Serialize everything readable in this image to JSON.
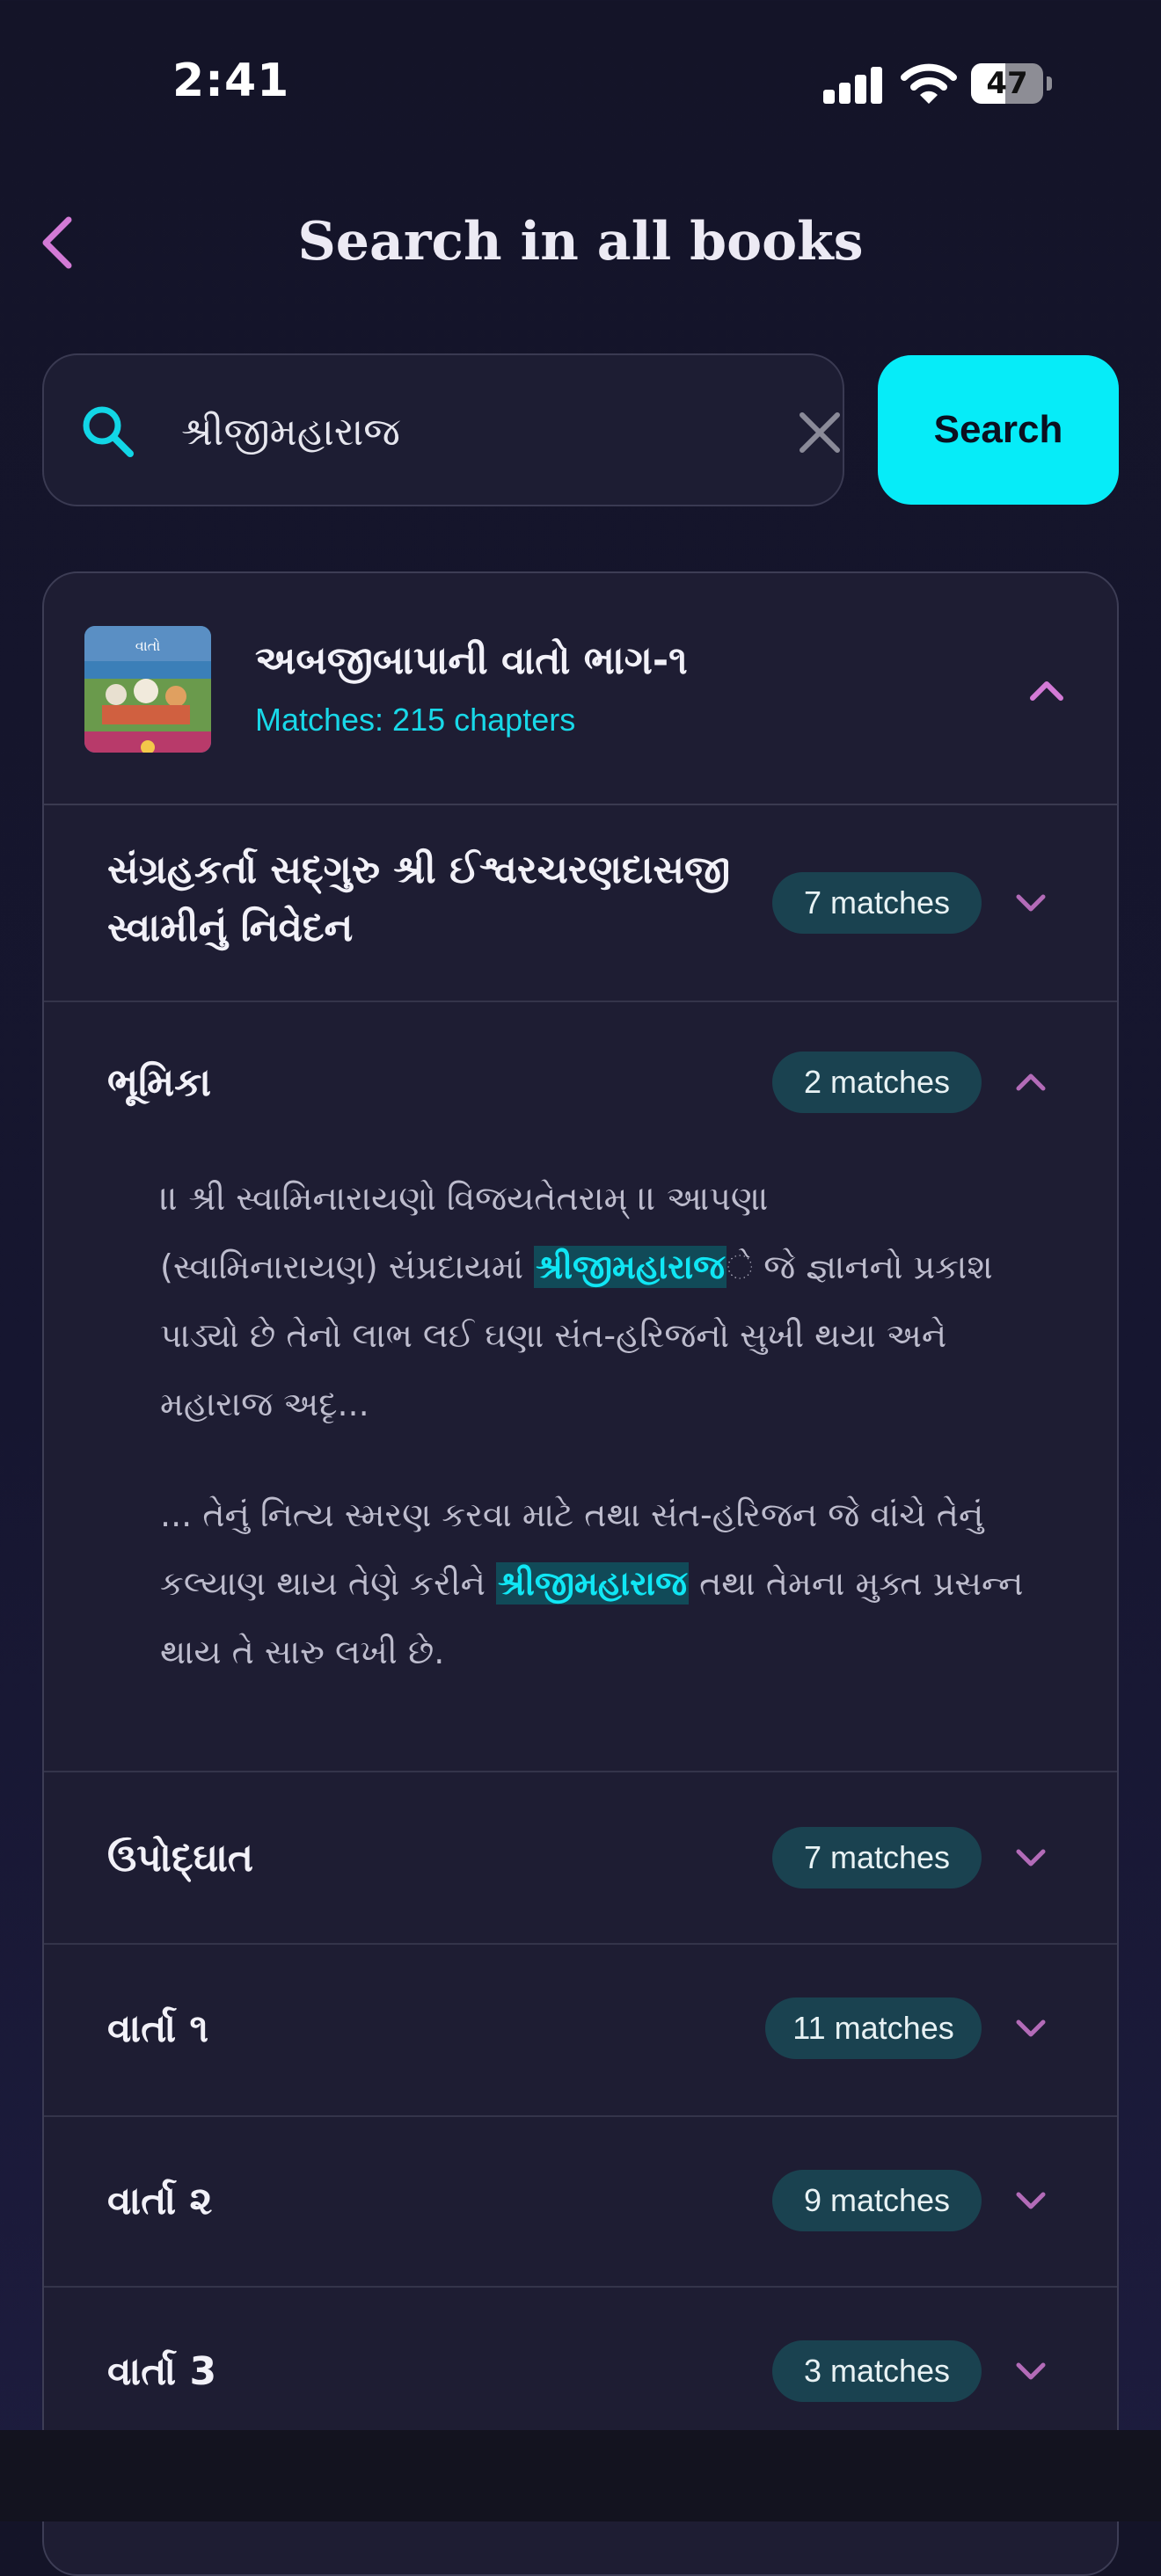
{
  "status_bar": {
    "time": "2:41",
    "battery": "47",
    "battery_level": 0.47
  },
  "header": {
    "title": "Search in all books",
    "back_icon": "chevron-left-icon"
  },
  "search": {
    "query": "શ્રીજીમહારાજ",
    "placeholder": "",
    "button_label": "Search"
  },
  "book": {
    "title": "અબજીબાપાની વાતો ભાગ-૧",
    "matches": "Matches: 215 chapters",
    "cover_text": "વાતો",
    "expanded": true
  },
  "chapters": [
    {
      "title_line1": "સંગ્રહકર્તા સદ્‌ગુરુ શ્રી ઈશ્વરચરણદાસજી",
      "title_line2": "સ્વામીનું નિવેદન",
      "matches": "7 matches",
      "expanded": false
    },
    {
      "title": "ભૂમિકા",
      "matches": "2 matches",
      "expanded": true
    },
    {
      "title": "ઉપોદ્‌ઘાત",
      "matches": "7 matches",
      "expanded": false
    },
    {
      "title": "વાર્તા ૧",
      "matches": "11 matches",
      "expanded": false
    },
    {
      "title": "વાર્તા ૨",
      "matches": "9 matches",
      "expanded": false
    },
    {
      "title": "વાર્તા 3",
      "matches": "3 matches",
      "expanded": false
    }
  ],
  "snippets": [
    {
      "l1": "।। શ્રી સ્વામિનારાયણો વિજયતેતરામ્ ।। આપણા",
      "l2_pre": "(સ્વામિનારાયણ) સંપ્રદાયમાં ",
      "l2_hl": "શ્રીજીમહારાજ",
      "l2_post": "ે જે જ્ઞાનનો પ્રકાશ",
      "l3": "પાડ્યો છે તેનો લાભ લઈ ઘણા સંત-હરિજનો સુખી થયા અને",
      "l4": "મહારાજ અદૃ..."
    },
    {
      "l1": "... તેનું નિત્ય સ્મરણ કરવા માટે તથા સંત-હરિજન જે વાંચે તેનું",
      "l2_pre": "કલ્યાણ થાય તેણે કરીને ",
      "l2_hl": "શ્રીજીમહારાજ",
      "l2_post": " તથા તેમના મુક્ત પ્રસન્ન",
      "l3": "થાય તે સારુ લખી છે."
    }
  ],
  "colors": {
    "accent": "#06ecf8",
    "chevron": "#d37ad6",
    "badge_bg": "#1a4250",
    "highlight_bg": "#114a58"
  }
}
